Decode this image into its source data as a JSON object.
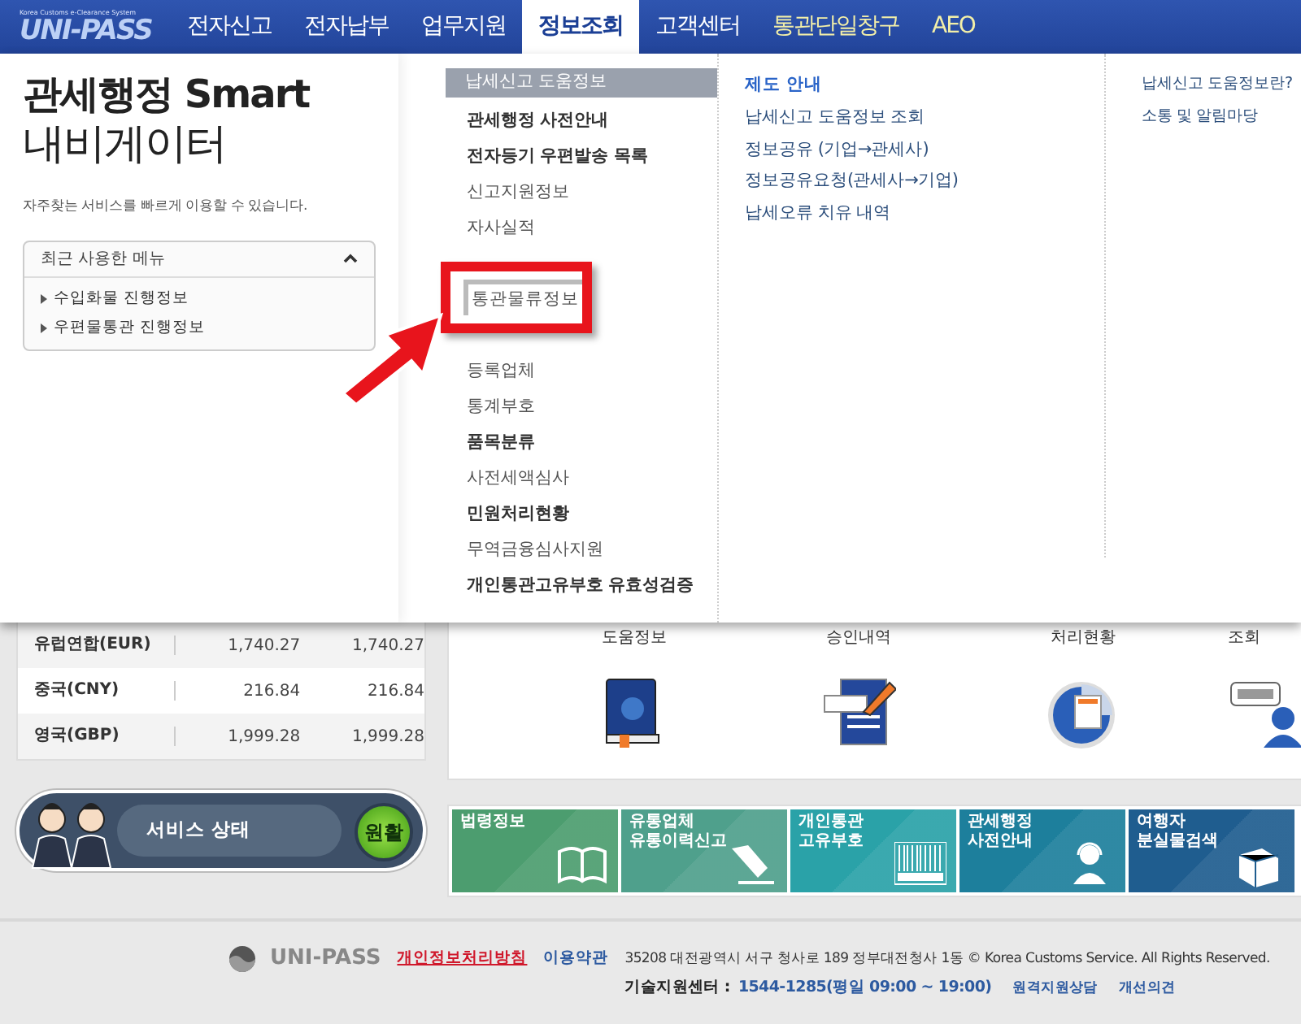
{
  "header": {
    "logo": "UNI-PASS",
    "tagline": "Korea Customs e-Clearance System",
    "nav": [
      {
        "label": "전자신고",
        "selected": false,
        "kind": "main"
      },
      {
        "label": "전자납부",
        "selected": false,
        "kind": "main"
      },
      {
        "label": "업무지원",
        "selected": false,
        "kind": "main"
      },
      {
        "label": "정보조회",
        "selected": true,
        "kind": "main"
      },
      {
        "label": "고객센터",
        "selected": false,
        "kind": "main"
      },
      {
        "label": "통관단일창구",
        "selected": false,
        "kind": "special"
      },
      {
        "label": "AEO",
        "selected": false,
        "kind": "special"
      }
    ]
  },
  "navigator": {
    "title": "관세행정 Smart",
    "subtitle": "내비게이터",
    "description": "자주찾는 서비스를 빠르게 이용할 수 있습니다.",
    "recent": {
      "title": "최근 사용한 메뉴",
      "expanded": true,
      "items": [
        "수입화물 진행정보",
        "우편물통관 진행정보"
      ]
    }
  },
  "menu": {
    "column_1": [
      {
        "label": "납세신고 도움정보",
        "kind": "group",
        "selected": true
      },
      {
        "label": "관세행정 사전안내",
        "kind": "group",
        "selected": false
      },
      {
        "label": "전자등기 우편발송 목록",
        "kind": "group",
        "selected": false
      },
      {
        "label": "신고지원정보",
        "kind": "link",
        "selected": false
      },
      {
        "label": "자사실적",
        "kind": "link",
        "selected": false
      },
      {
        "label": "통관물류정보",
        "kind": "callout",
        "selected": false
      },
      {
        "label": "등록업체",
        "kind": "link",
        "selected": false
      },
      {
        "label": "통계부호",
        "kind": "link",
        "selected": false
      },
      {
        "label": "품목분류",
        "kind": "group",
        "selected": false
      },
      {
        "label": "사전세액심사",
        "kind": "link",
        "selected": false
      },
      {
        "label": "민원처리현황",
        "kind": "group",
        "selected": false
      },
      {
        "label": "무역금융심사지원",
        "kind": "link",
        "selected": false
      },
      {
        "label": "개인통관고유부호 유효성검증",
        "kind": "group",
        "selected": false
      }
    ],
    "column_2": {
      "heading": "제도 안내",
      "items": [
        "납세신고 도움정보 조회",
        "정보공유 (기업→관세사)",
        "정보공유요청(관세사→기업)",
        "납세오류 치유 내역"
      ]
    },
    "column_3": [
      "납세신고 도움정보란?",
      "소통 및 알림마당"
    ]
  },
  "exchange_rates": [
    {
      "currency": "유럽연합(EUR)",
      "values": [
        "1,740.27",
        "1,740.27"
      ]
    },
    {
      "currency": "중국(CNY)",
      "values": [
        "216.84",
        "216.84"
      ]
    },
    {
      "currency": "영국(GBP)",
      "values": [
        "1,999.28",
        "1,999.28"
      ]
    }
  ],
  "shortcuts": [
    {
      "label": "도움정보"
    },
    {
      "label": "승인내역"
    },
    {
      "label": "처리현황"
    },
    {
      "label": "조회"
    }
  ],
  "service_status": {
    "label": "서비스 상태",
    "status": "원활"
  },
  "tiles": [
    {
      "lines": [
        "법령정보"
      ],
      "color": "#4c9d6f"
    },
    {
      "lines": [
        "유통업체",
        "유통이력신고"
      ],
      "color": "#4fa08c"
    },
    {
      "lines": [
        "개인통관",
        "고유부호"
      ],
      "color": "#2aa2a8"
    },
    {
      "lines": [
        "관세행정",
        "사전안내"
      ],
      "color": "#1d7f9c"
    },
    {
      "lines": [
        "여행자",
        "분실물검색"
      ],
      "color": "#1f5d8f"
    }
  ],
  "footer": {
    "logo": "UNI-PASS",
    "links": [
      {
        "label": "개인정보처리방침",
        "kind": "privacy"
      },
      {
        "label": "이용약관",
        "kind": "normal"
      }
    ],
    "address": "35208 대전광역시 서구 청사로 189 정부대전청사 1동 © Korea Customs Service. All Rights Reserved.",
    "support_label": "기술지원센터 :",
    "support_phone": "1544-1285(평일 09:00 ~ 19:00)",
    "support_links": [
      "원격지원상담",
      "개선의견"
    ]
  }
}
